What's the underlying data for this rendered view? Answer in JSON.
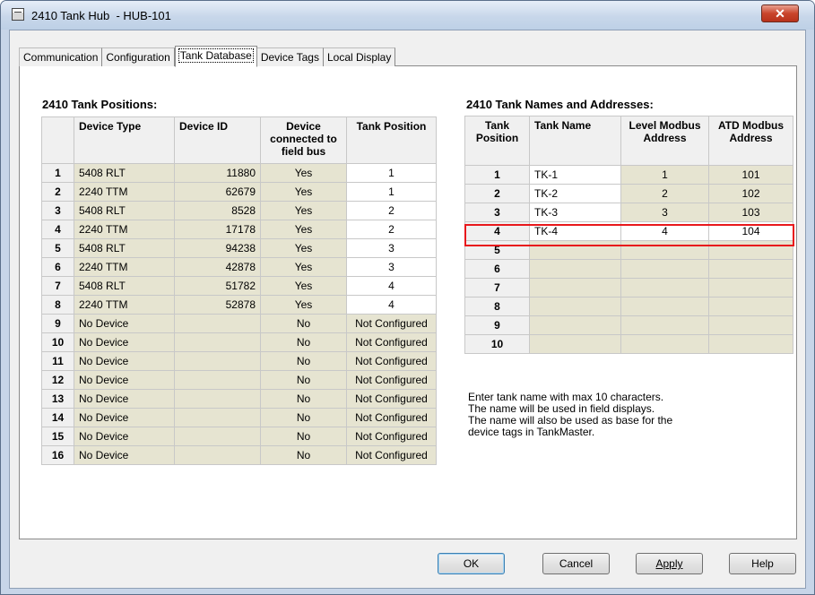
{
  "window": {
    "title": "2410 Tank Hub  - HUB-101",
    "close_glyph": "✕"
  },
  "tabs": [
    {
      "label": "Communication",
      "active": false
    },
    {
      "label": "Configuration",
      "active": false
    },
    {
      "label": "Tank Database",
      "active": true
    },
    {
      "label": "Device Tags",
      "active": false
    },
    {
      "label": "Local Display",
      "active": false
    }
  ],
  "positions": {
    "title": "2410 Tank Positions:",
    "headers": {
      "device_type": "Device Type",
      "device_id": "Device ID",
      "connected": "Device connected to field bus",
      "tank_position": "Tank Position"
    },
    "rows": [
      {
        "index": "1",
        "device_type": "5408 RLT",
        "device_id": "11880",
        "connected": "Yes",
        "tank_position": "1"
      },
      {
        "index": "2",
        "device_type": "2240 TTM",
        "device_id": "62679",
        "connected": "Yes",
        "tank_position": "1"
      },
      {
        "index": "3",
        "device_type": "5408 RLT",
        "device_id": "8528",
        "connected": "Yes",
        "tank_position": "2"
      },
      {
        "index": "4",
        "device_type": "2240 TTM",
        "device_id": "17178",
        "connected": "Yes",
        "tank_position": "2"
      },
      {
        "index": "5",
        "device_type": "5408 RLT",
        "device_id": "94238",
        "connected": "Yes",
        "tank_position": "3"
      },
      {
        "index": "6",
        "device_type": "2240 TTM",
        "device_id": "42878",
        "connected": "Yes",
        "tank_position": "3"
      },
      {
        "index": "7",
        "device_type": "5408 RLT",
        "device_id": "51782",
        "connected": "Yes",
        "tank_position": "4"
      },
      {
        "index": "8",
        "device_type": "2240 TTM",
        "device_id": "52878",
        "connected": "Yes",
        "tank_position": "4"
      },
      {
        "index": "9",
        "device_type": "No Device",
        "device_id": "",
        "connected": "No",
        "tank_position": "Not Configured"
      },
      {
        "index": "10",
        "device_type": "No Device",
        "device_id": "",
        "connected": "No",
        "tank_position": "Not Configured"
      },
      {
        "index": "11",
        "device_type": "No Device",
        "device_id": "",
        "connected": "No",
        "tank_position": "Not Configured"
      },
      {
        "index": "12",
        "device_type": "No Device",
        "device_id": "",
        "connected": "No",
        "tank_position": "Not Configured"
      },
      {
        "index": "13",
        "device_type": "No Device",
        "device_id": "",
        "connected": "No",
        "tank_position": "Not Configured"
      },
      {
        "index": "14",
        "device_type": "No Device",
        "device_id": "",
        "connected": "No",
        "tank_position": "Not Configured"
      },
      {
        "index": "15",
        "device_type": "No Device",
        "device_id": "",
        "connected": "No",
        "tank_position": "Not Configured"
      },
      {
        "index": "16",
        "device_type": "No Device",
        "device_id": "",
        "connected": "No",
        "tank_position": "Not Configured"
      }
    ]
  },
  "names": {
    "title": "2410 Tank Names and Addresses:",
    "headers": {
      "tank_position": "Tank Position",
      "tank_name": "Tank Name",
      "level_modbus": "Level Modbus Address",
      "atd_modbus": "ATD Modbus Address"
    },
    "rows": [
      {
        "position": "1",
        "tank_name": "TK-1",
        "level_modbus": "1",
        "atd_modbus": "101"
      },
      {
        "position": "2",
        "tank_name": "TK-2",
        "level_modbus": "2",
        "atd_modbus": "102"
      },
      {
        "position": "3",
        "tank_name": "TK-3",
        "level_modbus": "3",
        "atd_modbus": "103"
      },
      {
        "position": "4",
        "tank_name": "TK-4",
        "level_modbus": "4",
        "atd_modbus": "104"
      },
      {
        "position": "5",
        "tank_name": "",
        "level_modbus": "",
        "atd_modbus": ""
      },
      {
        "position": "6",
        "tank_name": "",
        "level_modbus": "",
        "atd_modbus": ""
      },
      {
        "position": "7",
        "tank_name": "",
        "level_modbus": "",
        "atd_modbus": ""
      },
      {
        "position": "8",
        "tank_name": "",
        "level_modbus": "",
        "atd_modbus": ""
      },
      {
        "position": "9",
        "tank_name": "",
        "level_modbus": "",
        "atd_modbus": ""
      },
      {
        "position": "10",
        "tank_name": "",
        "level_modbus": "",
        "atd_modbus": ""
      }
    ],
    "note": "Enter tank name with max 10 characters.\nThe name will be used in field displays.\nThe name will also be used as base for the\ndevice tags in TankMaster."
  },
  "buttons": {
    "ok": "OK",
    "cancel": "Cancel",
    "apply": "Apply",
    "help": "Help"
  },
  "colors": {
    "highlight": "#e8181c",
    "readonly_cell": "#e6e4d1",
    "editable_cell": "#ffffff"
  }
}
